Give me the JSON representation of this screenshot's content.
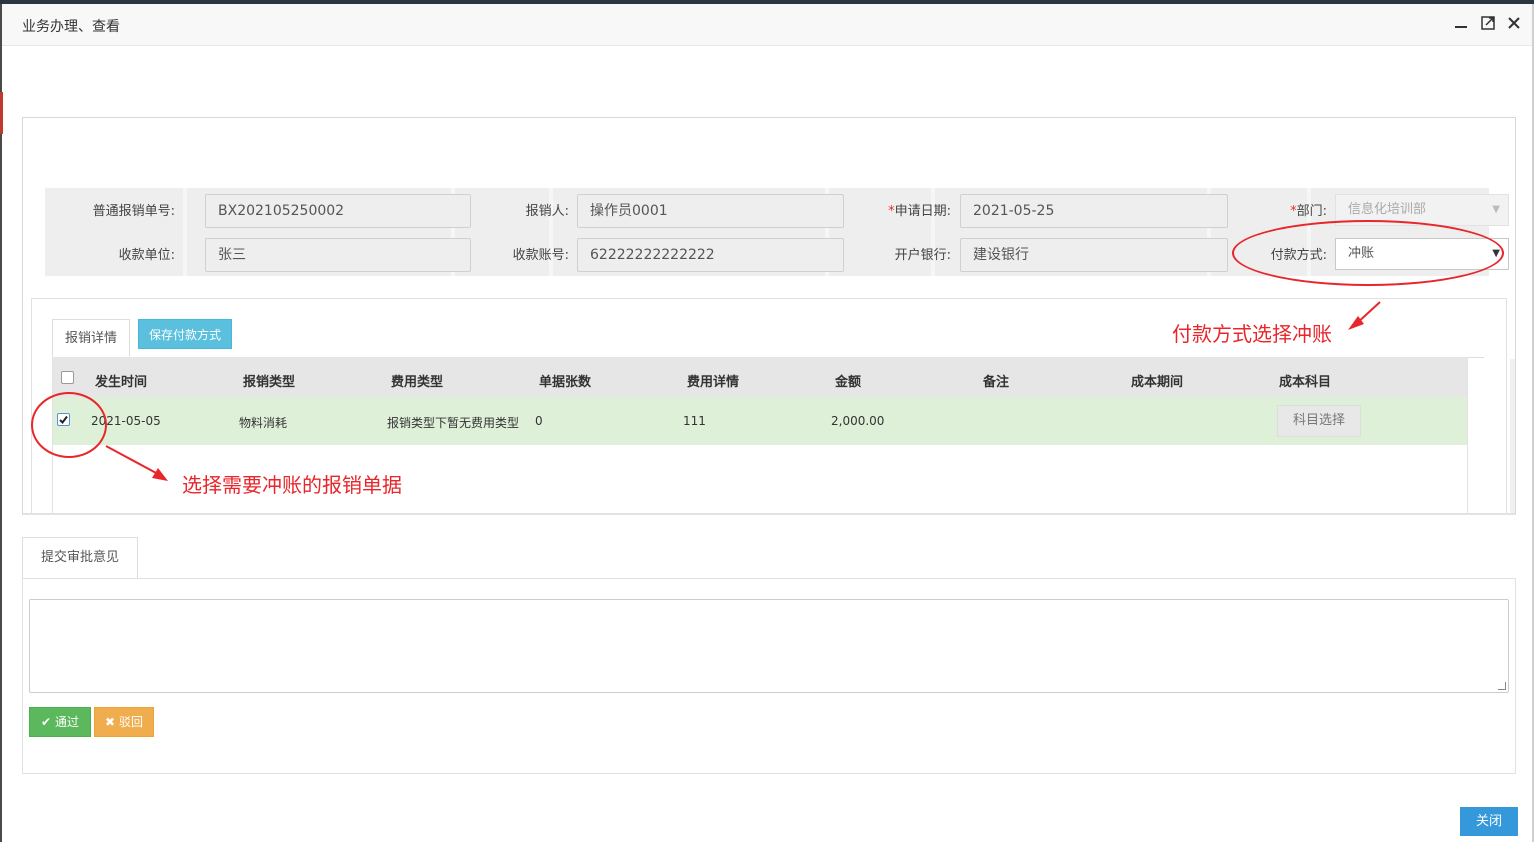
{
  "window": {
    "title": "业务办理、查看",
    "minimize_icon": "minimize-icon",
    "maximize_icon": "maximize-icon",
    "close_icon": "close-icon"
  },
  "form": {
    "order_no_label": "普通报销单号:",
    "order_no_value": "BX202105250002",
    "applicant_label": "报销人:",
    "applicant_value": "操作员0001",
    "apply_date_label": "申请日期:",
    "apply_date_value": "2021-05-25",
    "dept_label": "部门:",
    "dept_value": "信息化培训部",
    "payee_label": "收款单位:",
    "payee_value": "张三",
    "account_label": "收款账号:",
    "account_value": "62222222222222",
    "bank_label": "开户银行:",
    "bank_value": "建设银行",
    "pay_method_label": "付款方式:",
    "pay_method_value": "冲账",
    "required_mark": "*"
  },
  "tabs": {
    "detail_tab": "报销详情",
    "save_pay_button": "保存付款方式"
  },
  "table": {
    "headers": [
      "发生时间",
      "报销类型",
      "费用类型",
      "单据张数",
      "费用详情",
      "金额",
      "备注",
      "成本期间",
      "成本科目"
    ],
    "rows": [
      {
        "checked": true,
        "date": "2021-05-05",
        "reimb_type": "物料消耗",
        "fee_type": "报销类型下暂无费用类型",
        "doc_count": "0",
        "fee_detail": "111",
        "amount": "2,000.00",
        "remark": "",
        "cost_period": "",
        "subject_button": "科目选择"
      }
    ]
  },
  "approval": {
    "tab_label": "提交审批意见",
    "textarea_value": "",
    "pass_label": "通过",
    "pass_icon": "check-icon",
    "reject_label": "驳回",
    "reject_icon": "x-icon"
  },
  "footer": {
    "close_label": "关闭"
  },
  "annotations": {
    "pay_method_note": "付款方式选择冲账",
    "select_row_note": "选择需要冲账的报销单据",
    "color": "#e8262b"
  }
}
